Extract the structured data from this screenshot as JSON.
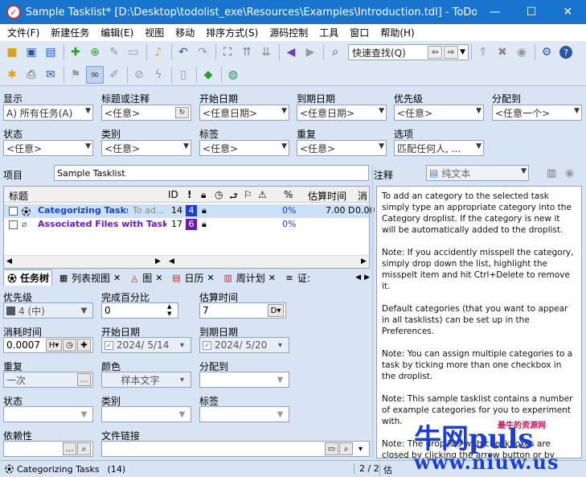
{
  "window": {
    "title": "Sample Tasklist* [D:\\Desktop\\todolist_exe\\Resources\\Examples\\Introduction.tdl] - ToDoList (c)...",
    "minimize": "—",
    "maximize": "☐",
    "close": "✕"
  },
  "menu": [
    "文件(F)",
    "新建任务",
    "编辑(E)",
    "视图",
    "移动",
    "排序方式(S)",
    "源码控制",
    "工具",
    "窗口",
    "帮助(H)"
  ],
  "quickfind": {
    "placeholder": "快速查找(Q)"
  },
  "filters": {
    "show_label": "显示",
    "show_value": "A)  所有任务(A)",
    "title_label": "标题或注释",
    "title_value": "<任意>",
    "start_label": "开始日期",
    "start_value": "<任意日期>",
    "due_label": "到期日期",
    "due_value": "<任意日期>",
    "priority_label": "优先级",
    "priority_value": "<任意>",
    "assign_label": "分配到",
    "assign_value": "<任意一个>",
    "status_label": "状态",
    "status_value": "<任意>",
    "category_label": "类别",
    "category_value": "<任意>",
    "tag_label": "标签",
    "tag_value": "<任意>",
    "recur_label": "重复",
    "recur_value": "<任意>",
    "options_label": "选项",
    "options_value": "匹配任何人, ..."
  },
  "project": {
    "label": "项目",
    "value": "Sample Tasklist"
  },
  "tasklist": {
    "columns": {
      "title": "标题",
      "id": "ID",
      "pct": "%",
      "est": "估算时间",
      "more": "消"
    },
    "rows": [
      {
        "title": "Categorizing Tasks",
        "extra": "To ad...",
        "id": "14",
        "prio": "4",
        "pct": "0%",
        "est": "7.00 D",
        "more": "0.00"
      },
      {
        "title": "Associated Files with Tasks",
        "extra": "",
        "id": "17",
        "prio": "6",
        "pct": "0%",
        "est": "",
        "more": ""
      }
    ]
  },
  "tabs": [
    "任务树",
    "列表视图",
    "图",
    "日历",
    "周计划",
    "证:"
  ],
  "attributes": {
    "priority_label": "优先级",
    "priority_value": "4 (中)",
    "pct_label": "完成百分比",
    "pct_value": "0",
    "est_label": "估算时间",
    "est_value": "7",
    "est_unit": "D",
    "spent_label": "消耗时间",
    "spent_value": "0.0007",
    "spent_unit": "H",
    "start_label": "开始日期",
    "start_value": "2024/  5/14",
    "due_label": "到期日期",
    "due_value": "2024/  5/20",
    "recur_label": "重复",
    "recur_value": "一次",
    "color_label": "颜色",
    "color_value": "样本文字",
    "assign_label": "分配到",
    "status_label": "状态",
    "category_label": "类别",
    "tag_label": "标签",
    "depends_label": "依赖性",
    "filelink_label": "文件链接"
  },
  "comments": {
    "label": "注释",
    "format": "纯文本",
    "paragraphs": [
      "To add an category to the selected task simply type an appropriate category into the Category droplist. If the category is new it will be automatically added to the droplist.",
      "Note: If you accidently misspell the category, simply drop down the list, highlight the misspelt item and hit Ctrl+Delete to remove it.",
      "Default categories (that you want to appear in all tasklists) can be set up in the Preferences.",
      "Note: You can assign multiple categories to a task by ticking more than one checkbox in the droplist.",
      "Note: This sample tasklist contains a number of example categories for you to experiment with.",
      "Note: The droplists with checkboxes are closed by clicking the arrow button or by hitting Return."
    ]
  },
  "status": {
    "task": "Categorizing Tasks",
    "count": "(14)",
    "pages": "2 / 2",
    "more": "估"
  },
  "watermark": {
    "main": "牛网puls",
    "tag": "最牛的资源网",
    "url": "www.niuw.us"
  },
  "colors": {
    "titlebar": "#1874cd",
    "selection": "#cce0f7",
    "task_blue": "#1d3fd1",
    "task_purple": "#6a1bb5"
  }
}
